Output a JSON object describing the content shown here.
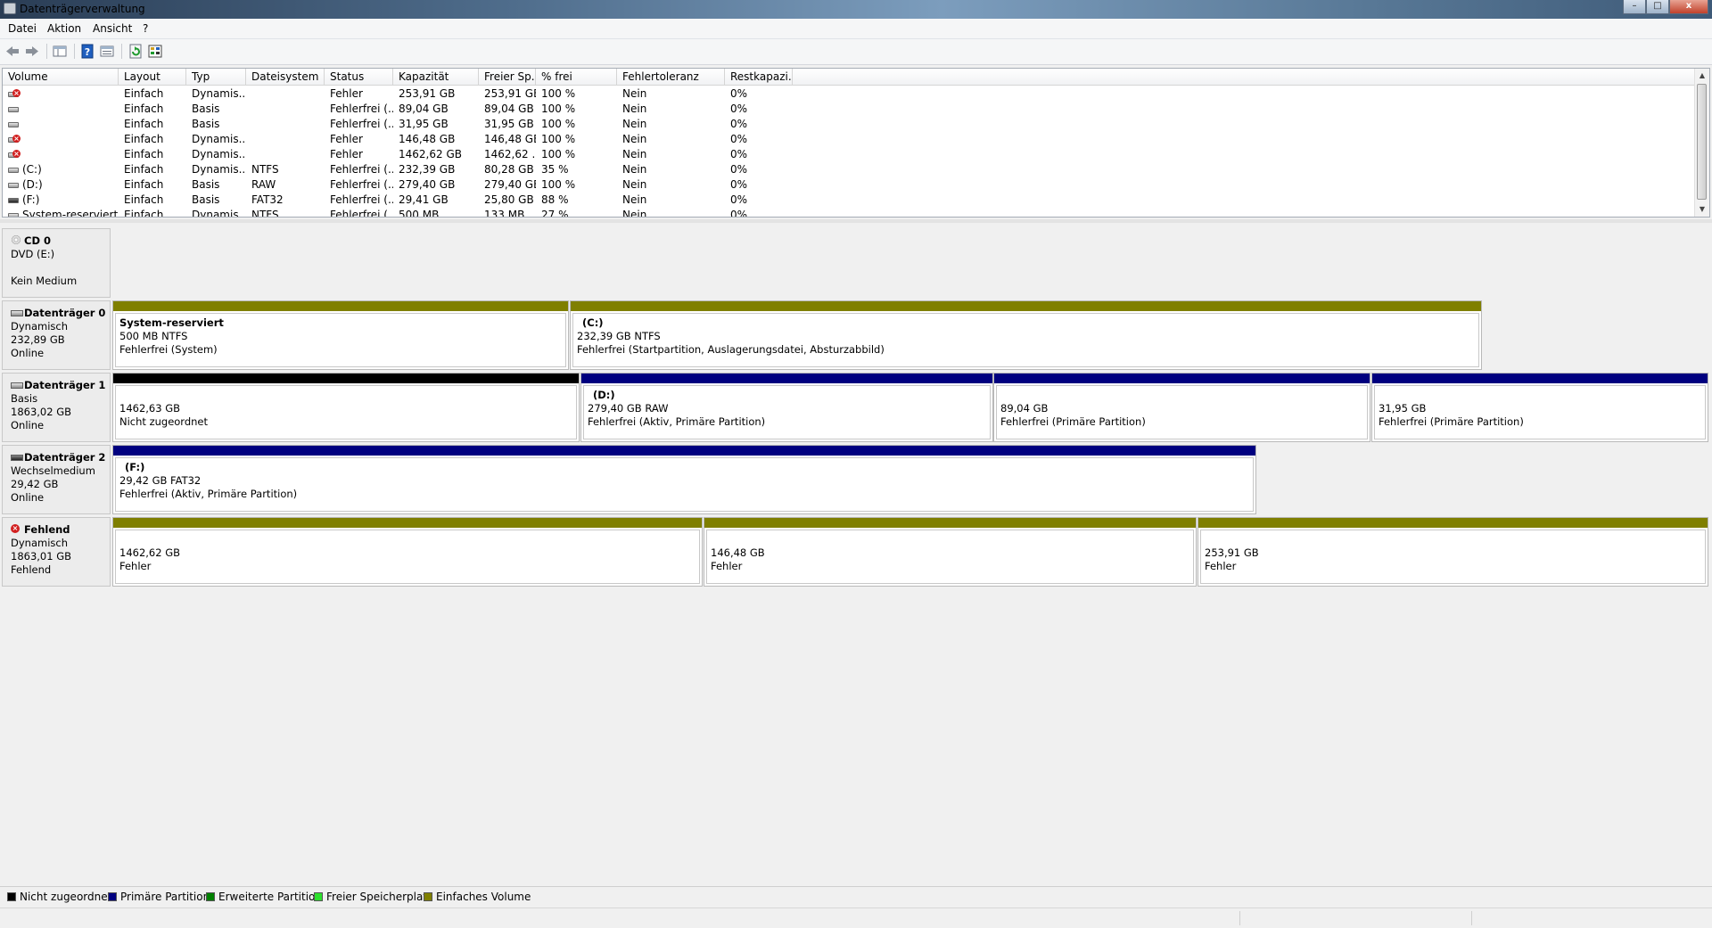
{
  "window": {
    "title": "Datenträgerverwaltung",
    "controls": [
      "–",
      "□",
      "x"
    ]
  },
  "menu": [
    "Datei",
    "Aktion",
    "Ansicht",
    "?"
  ],
  "toolbar": [
    "back-icon",
    "forward-icon",
    "console-tree-icon",
    "help-icon",
    "properties-icon",
    "refresh-icon",
    "rescan-icon"
  ],
  "volume_list": {
    "headers": [
      "Volume",
      "Layout",
      "Typ",
      "Dateisystem",
      "Status",
      "Kapazität",
      "Freier Sp...",
      "% frei",
      "Fehlertoleranz",
      "Restkapazi..."
    ],
    "rows": [
      {
        "icon": "error",
        "volume": "",
        "layout": "Einfach",
        "typ": "Dynamis...",
        "fs": "",
        "status": "Fehler",
        "cap": "253,91 GB",
        "free": "253,91 GB",
        "pct": "100 %",
        "ft": "Nein",
        "rest": "0%"
      },
      {
        "icon": "drive",
        "volume": "",
        "layout": "Einfach",
        "typ": "Basis",
        "fs": "",
        "status": "Fehlerfrei (...",
        "cap": "89,04 GB",
        "free": "89,04 GB",
        "pct": "100 %",
        "ft": "Nein",
        "rest": "0%"
      },
      {
        "icon": "drive",
        "volume": "",
        "layout": "Einfach",
        "typ": "Basis",
        "fs": "",
        "status": "Fehlerfrei (...",
        "cap": "31,95 GB",
        "free": "31,95 GB",
        "pct": "100 %",
        "ft": "Nein",
        "rest": "0%"
      },
      {
        "icon": "error",
        "volume": "",
        "layout": "Einfach",
        "typ": "Dynamis...",
        "fs": "",
        "status": "Fehler",
        "cap": "146,48 GB",
        "free": "146,48 GB",
        "pct": "100 %",
        "ft": "Nein",
        "rest": "0%"
      },
      {
        "icon": "error",
        "volume": "",
        "layout": "Einfach",
        "typ": "Dynamis...",
        "fs": "",
        "status": "Fehler",
        "cap": "1462,62 GB",
        "free": "1462,62 ...",
        "pct": "100 %",
        "ft": "Nein",
        "rest": "0%"
      },
      {
        "icon": "drive",
        "volume": "(C:)",
        "layout": "Einfach",
        "typ": "Dynamis...",
        "fs": "NTFS",
        "status": "Fehlerfrei (...",
        "cap": "232,39 GB",
        "free": "80,28 GB",
        "pct": "35 %",
        "ft": "Nein",
        "rest": "0%"
      },
      {
        "icon": "drive",
        "volume": "(D:)",
        "layout": "Einfach",
        "typ": "Basis",
        "fs": "RAW",
        "status": "Fehlerfrei (...",
        "cap": "279,40 GB",
        "free": "279,40 GB",
        "pct": "100 %",
        "ft": "Nein",
        "rest": "0%"
      },
      {
        "icon": "dark",
        "volume": "(F:)",
        "layout": "Einfach",
        "typ": "Basis",
        "fs": "FAT32",
        "status": "Fehlerfrei (...",
        "cap": "29,41 GB",
        "free": "25,80 GB",
        "pct": "88 %",
        "ft": "Nein",
        "rest": "0%"
      },
      {
        "icon": "drive",
        "volume": "System-reserviert",
        "layout": "Einfach",
        "typ": "Dynamis...",
        "fs": "NTFS",
        "status": "Fehlerfrei (...",
        "cap": "500 MB",
        "free": "133 MB",
        "pct": "27 %",
        "ft": "Nein",
        "rest": "0%"
      }
    ]
  },
  "disks": [
    {
      "icon": "cd",
      "name": "CD 0",
      "line1": "DVD (E:)",
      "line2": "",
      "line3": "Kein Medium",
      "partitions": []
    },
    {
      "icon": "drive",
      "name": "Datenträger 0",
      "line1": "Dynamisch",
      "line2": "232,89 GB",
      "line3": "Online",
      "partitions": [
        {
          "name": "System-reserviert",
          "size": "500 MB NTFS",
          "status": "Fehlerfrei (System)",
          "kind": "simple"
        },
        {
          "name": "(C:)",
          "size": "232,39 GB NTFS",
          "status": "Fehlerfrei (Startpartition, Auslagerungsdatei, Absturzabbild)",
          "kind": "simple"
        }
      ]
    },
    {
      "icon": "drive",
      "name": "Datenträger 1",
      "line1": "Basis",
      "line2": "1863,02 GB",
      "line3": "Online",
      "partitions": [
        {
          "name": "",
          "size": "1462,63 GB",
          "status": "Nicht zugeordnet",
          "kind": "unallocated"
        },
        {
          "name": "(D:)",
          "size": "279,40 GB RAW",
          "status": "Fehlerfrei (Aktiv, Primäre Partition)",
          "kind": "primary"
        },
        {
          "name": "",
          "size": "89,04 GB",
          "status": "Fehlerfrei (Primäre Partition)",
          "kind": "primary"
        },
        {
          "name": "",
          "size": "31,95 GB",
          "status": "Fehlerfrei (Primäre Partition)",
          "kind": "primary"
        }
      ]
    },
    {
      "icon": "dark",
      "name": "Datenträger 2",
      "line1": "Wechselmedium",
      "line2": "29,42 GB",
      "line3": "Online",
      "partitions": [
        {
          "name": "(F:)",
          "size": "29,42 GB FAT32",
          "status": "Fehlerfrei (Aktiv, Primäre Partition)",
          "kind": "primary"
        }
      ]
    },
    {
      "icon": "error",
      "name": "Fehlend",
      "line1": "Dynamisch",
      "line2": "1863,01 GB",
      "line3": "Fehlend",
      "partitions": [
        {
          "name": "",
          "size": "1462,62 GB",
          "status": "Fehler",
          "kind": "simple"
        },
        {
          "name": "",
          "size": "146,48 GB",
          "status": "Fehler",
          "kind": "simple"
        },
        {
          "name": "",
          "size": "253,91 GB",
          "status": "Fehler",
          "kind": "simple"
        }
      ]
    }
  ],
  "legend": [
    {
      "label": "Nicht zugeordnet",
      "color": "#000000"
    },
    {
      "label": "Primäre Partition",
      "color": "#000080"
    },
    {
      "label": "Erweiterte Partition",
      "color": "#008000"
    },
    {
      "label": "Freier Speicherplatz",
      "color": "#2de02d"
    },
    {
      "label": "Einfaches Volume",
      "color": "#808000"
    }
  ],
  "colors": {
    "unallocated": "#000000",
    "primary": "#00007f",
    "simple": "#7f7f00"
  }
}
